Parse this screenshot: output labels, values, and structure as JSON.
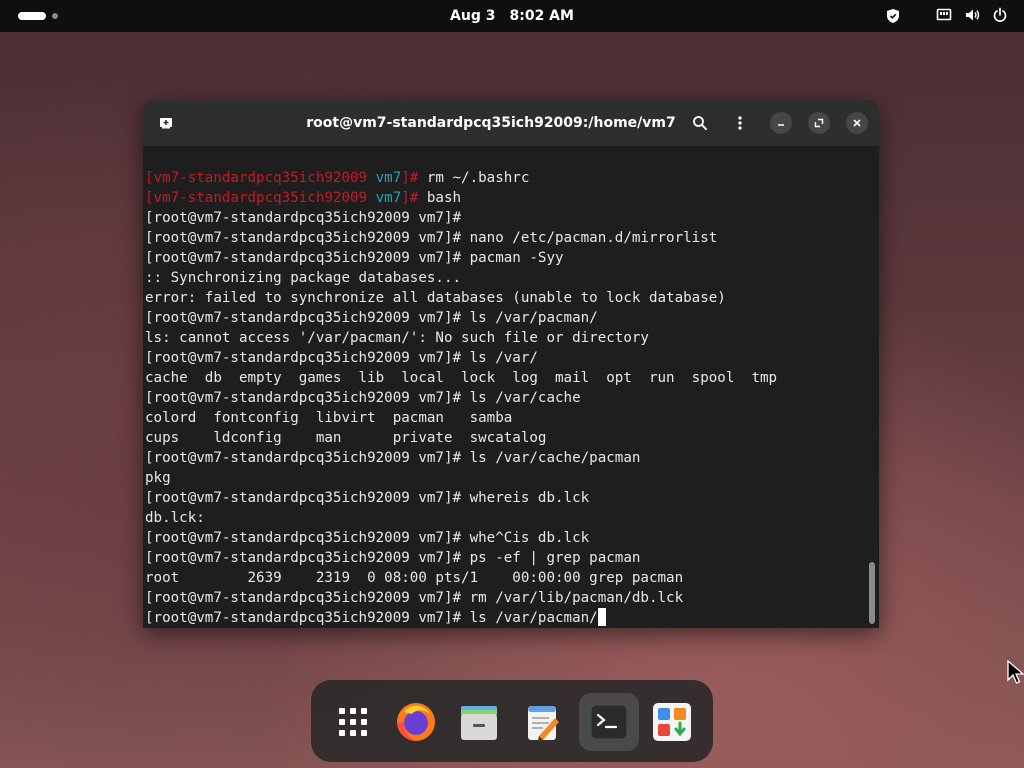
{
  "topbar": {
    "date": "Aug 3",
    "time": "8:02 AM",
    "icons": [
      "activities-indicator",
      "security-shield-icon",
      "network-wired-icon",
      "volume-icon",
      "power-icon"
    ]
  },
  "window": {
    "title": "root@vm7-standardpcq35ich92009:/home/vm7",
    "header_icons": [
      "new-tab-icon",
      "search-icon",
      "menu-kebab-icon",
      "minimize-icon",
      "restore-icon",
      "close-icon"
    ]
  },
  "terminal": {
    "lines": [
      {
        "prompt_red": "[vm7-standardpcq35ich92009 ",
        "prompt_cyan": "vm7",
        "prompt_end": "]# ",
        "text": "rm ~/.bashrc"
      },
      {
        "prompt_red": "[vm7-standardpcq35ich92009 ",
        "prompt_cyan": "vm7",
        "prompt_end": "]# ",
        "text": "bash"
      },
      {
        "text": "[root@vm7-standardpcq35ich92009 vm7]#"
      },
      {
        "text": "[root@vm7-standardpcq35ich92009 vm7]# nano /etc/pacman.d/mirrorlist"
      },
      {
        "text": "[root@vm7-standardpcq35ich92009 vm7]# pacman -Syy"
      },
      {
        "text": ":: Synchronizing package databases..."
      },
      {
        "text": "error: failed to synchronize all databases (unable to lock database)"
      },
      {
        "text": "[root@vm7-standardpcq35ich92009 vm7]# ls /var/pacman/"
      },
      {
        "text": "ls: cannot access '/var/pacman/': No such file or directory"
      },
      {
        "text": "[root@vm7-standardpcq35ich92009 vm7]# ls /var/"
      },
      {
        "text": "cache  db  empty  games  lib  local  lock  log  mail  opt  run  spool  tmp"
      },
      {
        "text": "[root@vm7-standardpcq35ich92009 vm7]# ls /var/cache"
      },
      {
        "text": "colord  fontconfig  libvirt  pacman   samba"
      },
      {
        "text": "cups    ldconfig    man      private  swcatalog"
      },
      {
        "text": "[root@vm7-standardpcq35ich92009 vm7]# ls /var/cache/pacman"
      },
      {
        "text": "pkg"
      },
      {
        "text": "[root@vm7-standardpcq35ich92009 vm7]# whereis db.lck"
      },
      {
        "text": "db.lck:"
      },
      {
        "text": "[root@vm7-standardpcq35ich92009 vm7]# whe^Cis db.lck"
      },
      {
        "text": "[root@vm7-standardpcq35ich92009 vm7]# ps -ef | grep pacman"
      },
      {
        "text": "root        2639    2319  0 08:00 pts/1    00:00:00 grep pacman"
      },
      {
        "text": "[root@vm7-standardpcq35ich92009 vm7]# rm /var/lib/pacman/db.lck"
      },
      {
        "text": "[root@vm7-standardpcq35ich92009 vm7]# ls /var/pacman/"
      }
    ]
  },
  "dock": {
    "items": [
      {
        "name": "app-grid-icon",
        "label": "Show Apps"
      },
      {
        "name": "firefox-icon",
        "label": "Firefox"
      },
      {
        "name": "files-icon",
        "label": "Files"
      },
      {
        "name": "text-editor-icon",
        "label": "Text Editor"
      },
      {
        "name": "terminal-icon",
        "label": "Terminal",
        "active": true
      },
      {
        "name": "software-icon",
        "label": "Software"
      }
    ]
  },
  "colors": {
    "prompt_red": "#c01c28",
    "prompt_cyan": "#2aa1b3",
    "terminal_bg": "#1e1e1e",
    "headerbar_bg": "#2e2e2e"
  }
}
